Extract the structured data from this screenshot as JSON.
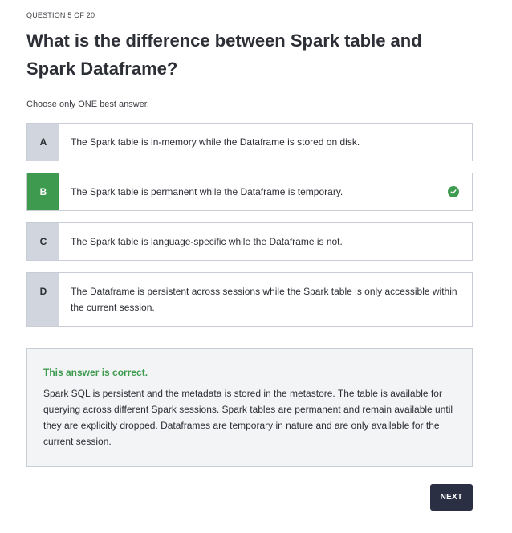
{
  "quiz": {
    "progress_label": "QUESTION 5 OF 20",
    "question": "What is the difference between Spark table and Spark Dataframe?",
    "instruction": "Choose only ONE best answer."
  },
  "options": [
    {
      "letter": "A",
      "text": "The Spark table is in-memory while the Dataframe is stored on disk.",
      "selected": false,
      "correct": false
    },
    {
      "letter": "B",
      "text": "The Spark table is permanent while the Dataframe is temporary.",
      "selected": true,
      "correct": true
    },
    {
      "letter": "C",
      "text": "The Spark table is language-specific while the Dataframe is not.",
      "selected": false,
      "correct": false
    },
    {
      "letter": "D",
      "text": "The Dataframe is persistent across sessions while the Spark table is only accessible within the current session.",
      "selected": false,
      "correct": false
    }
  ],
  "feedback": {
    "verdict": "This answer is correct.",
    "explanation": "Spark SQL is persistent and the metadata is stored in the metastore. The table is available for querying across different Spark sessions. Spark tables are permanent and remain available until they are explicitly dropped. Dataframes are temporary in nature and are only available for the current session."
  },
  "actions": {
    "next_label": "NEXT"
  },
  "colors": {
    "correct": "#3d9a4e",
    "letter_bg": "#d1d5dd",
    "button_bg": "#2b2f44",
    "feedback_bg": "#f3f4f6"
  },
  "icons": {
    "correct_marker": "check-circle-icon"
  }
}
